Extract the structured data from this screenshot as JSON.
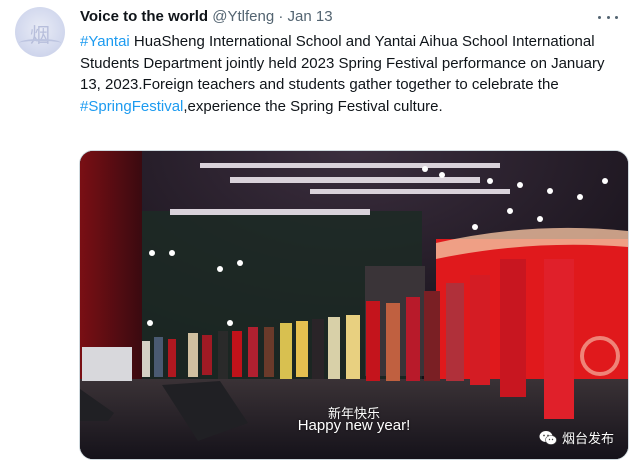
{
  "tweet": {
    "display_name": "Voice to the world",
    "handle": "@Ytlfeng",
    "separator": "·",
    "date": "Jan 13",
    "text": {
      "tag1": "#Yantai",
      "part1": " HuaSheng International School and Yantai Aihua School International Students Department jointly held 2023 Spring Festival performance on January 13, 2023.Foreign teachers and students gather together to celebrate the ",
      "tag2": "#SpringFestival",
      "part2": ",experience the Spring Festival culture."
    }
  },
  "media": {
    "caption_cn": "新年快乐",
    "caption_en": "Happy new year!",
    "watermark": "烟台发布"
  },
  "colors": {
    "link": "#1d9bf0",
    "text": "#0f1419",
    "muted": "#536471",
    "stage_red": "#e0191c"
  },
  "icons": {
    "more": "more-horizontal-icon",
    "avatar": "avatar-logo",
    "watermark": "wechat-icon"
  }
}
